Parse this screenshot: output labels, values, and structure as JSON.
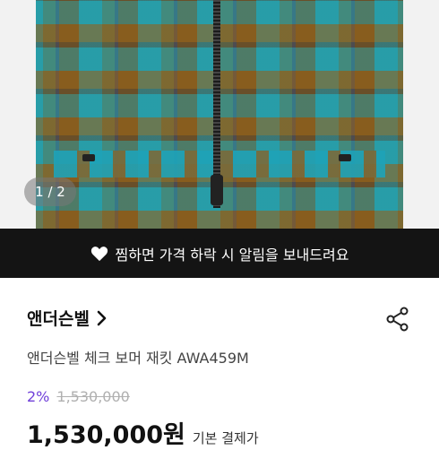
{
  "gallery": {
    "counter": "1 / 2",
    "image_description_icon": "plaid-jacket-photo"
  },
  "wish_banner": {
    "icon": "heart-icon",
    "text": "찜하면 가격 하락 시 알림을 보내드려요"
  },
  "product": {
    "brand": "앤더슨벨",
    "brand_icon": "chevron-right-icon",
    "share_icon": "share-icon",
    "name": "앤더슨벨 체크 보머 재킷 AWA459M",
    "discount": "2%",
    "original_price": "1,530,000",
    "price": "1,530,000원",
    "price_note": "기본 결제가"
  },
  "colors": {
    "discount": "#6f3fd9",
    "banner_bg": "#141414"
  }
}
